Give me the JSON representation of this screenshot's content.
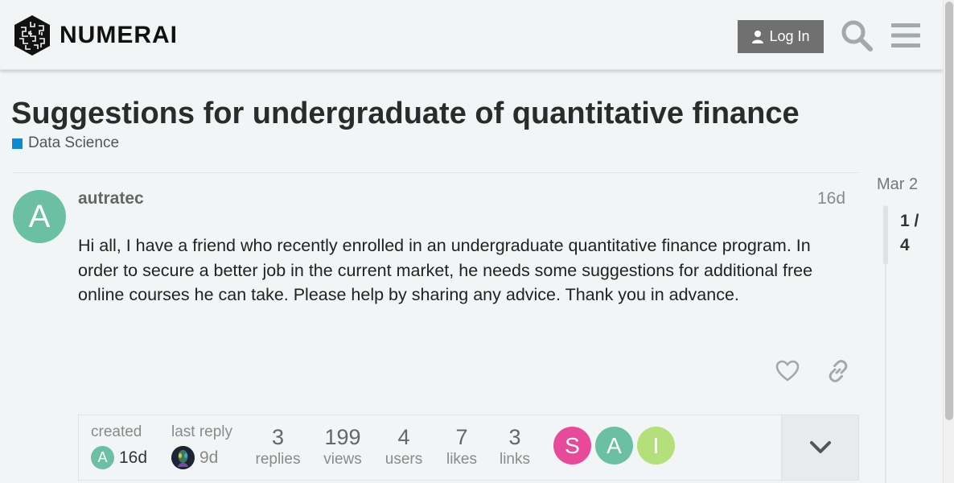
{
  "header": {
    "logo_text": "NUMERAI",
    "login_label": "Log In",
    "icons": [
      "numerai-logo-icon",
      "user-icon",
      "search-icon",
      "hamburger-menu-icon"
    ]
  },
  "topic": {
    "title": "Suggestions for undergraduate of quantitative finance",
    "category": "Data Science",
    "category_color": "#0d8bd1"
  },
  "post": {
    "avatar_letter": "A",
    "avatar_color": "#6bbfa3",
    "username": "autratec",
    "age": "16d",
    "body": "Hi all, I have a friend who recently enrolled in an undergraduate quantitative finance program. In order to secure a better job in the current market, he needs some suggestions for additional free online courses he can take. Please help by sharing any advice. Thank you in advance."
  },
  "topic_map": {
    "created_label": "created",
    "created_avatar": "A",
    "created_age": "16d",
    "last_reply_label": "last reply",
    "last_reply_age": "9d",
    "stats": [
      {
        "num": "3",
        "label": "replies"
      },
      {
        "num": "199",
        "label": "views"
      },
      {
        "num": "4",
        "label": "users"
      },
      {
        "num": "7",
        "label": "likes"
      },
      {
        "num": "3",
        "label": "links"
      }
    ],
    "participants": [
      {
        "letter": "S",
        "color": "#e84a9a"
      },
      {
        "letter": "A",
        "color": "#6bbfa3"
      },
      {
        "letter": "I",
        "color": "#b3e07a"
      }
    ]
  },
  "timeline": {
    "date": "Mar 2",
    "progress_line1": "1 /",
    "progress_line2": "4"
  }
}
